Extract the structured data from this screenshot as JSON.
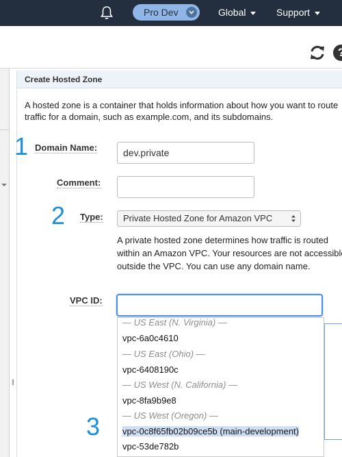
{
  "nav": {
    "account": "Pro Dev",
    "global": "Global",
    "support": "Support"
  },
  "icons": {
    "bell": "bell-icon",
    "refresh": "refresh-icon",
    "help": "help-icon",
    "help_glyph": "?"
  },
  "panel": {
    "title": "Create Hosted Zone",
    "intro": "A hosted zone is a container that holds information about how you want to route traffic for a domain, such as example.com, and its subdomains."
  },
  "steps": [
    "1",
    "2",
    "3"
  ],
  "form": {
    "domain_label": "Domain Name:",
    "domain_value": "dev.private",
    "comment_label": "Comment:",
    "comment_value": "",
    "type_label": "Type:",
    "type_value": "Private Hosted Zone for Amazon VPC",
    "type_help": "A private hosted zone determines how traffic is routed within an Amazon VPC. Your resources are not accessible outside the VPC. You can use any domain name.",
    "vpc_label": "VPC ID:",
    "vpc_value": ""
  },
  "vpc_options": [
    {
      "kind": "group",
      "label": "— US East (N. Virginia) —"
    },
    {
      "kind": "item",
      "label": "vpc-6a0c4610"
    },
    {
      "kind": "group",
      "label": "— US East (Ohio) —"
    },
    {
      "kind": "item",
      "label": "vpc-6408190c"
    },
    {
      "kind": "group",
      "label": "— US West (N. California) —"
    },
    {
      "kind": "item",
      "label": "vpc-8fa9b9e8"
    },
    {
      "kind": "group",
      "label": "— US West (Oregon) —"
    },
    {
      "kind": "item",
      "label": "vpc-0c8f65fb02b09ce5b (main-development)",
      "selected": true
    },
    {
      "kind": "item",
      "label": "vpc-53de782b"
    }
  ],
  "colors": {
    "nav_bg": "#232f3e",
    "accent": "#1b8fd8",
    "pill": "#8fb6e6",
    "focus": "#4a90e2"
  }
}
